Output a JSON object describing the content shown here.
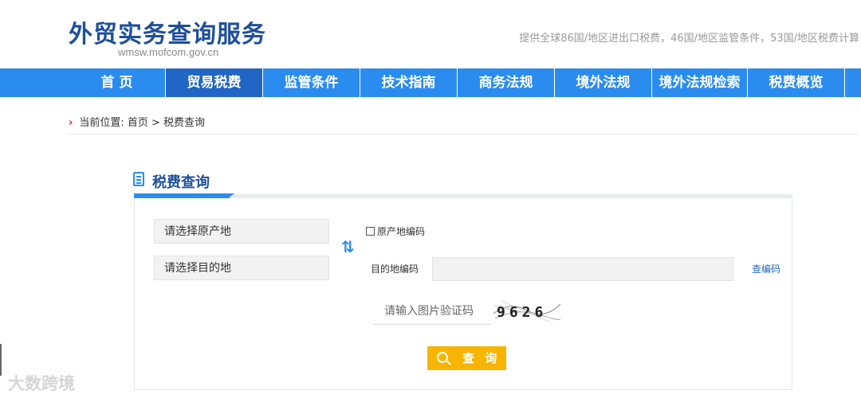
{
  "header": {
    "site_title": "外贸实务查询服务",
    "site_url": "wmsw.mofcom.gov.cn",
    "tagline": "提供全球86国/地区进出口税费，46国/地区监管条件，53国/地区税费计算"
  },
  "nav": {
    "items": [
      {
        "label": "首 页"
      },
      {
        "label": "贸易税费"
      },
      {
        "label": "监管条件"
      },
      {
        "label": "技术指南"
      },
      {
        "label": "商务法规"
      },
      {
        "label": "境外法规"
      },
      {
        "label": "境外法规检索"
      },
      {
        "label": "税费概览"
      }
    ],
    "active_index": 1
  },
  "breadcrumb": {
    "arrow": "›",
    "text": "当前位置: 首页 > 税费查询"
  },
  "section": {
    "title": "税费查询"
  },
  "form": {
    "origin_select": "请选择原产地",
    "destination_select": "请选择目的地",
    "swap_icon": "⇅",
    "origin_code_checkbox_label": "原产地编码",
    "origin_code_checked": false,
    "dest_code_label": "目的地编码",
    "dest_code_value": "",
    "lookup_link": "查编码",
    "captcha_placeholder": "请输入图片验证码",
    "captcha_text": "9626",
    "query_button": "查 询"
  },
  "watermark": {
    "text": "大数跨境"
  },
  "colors": {
    "brand_blue": "#1f4f9b",
    "nav_blue": "#2b8cf0",
    "nav_active": "#2166c4",
    "button_yellow": "#f7b500"
  }
}
